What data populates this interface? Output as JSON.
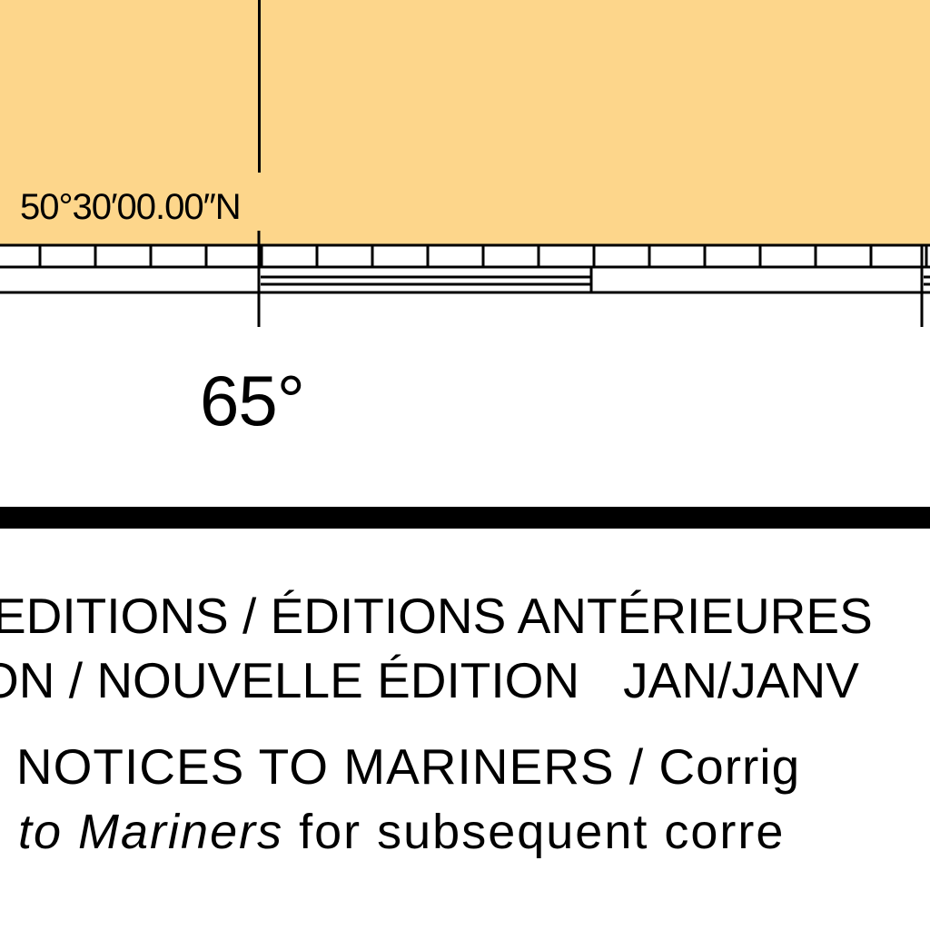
{
  "map": {
    "land_color": "#FDD68B",
    "latitude_label": "50°30′00.00″N",
    "longitude_label": "65°"
  },
  "notes": {
    "previous_editions": "EDITIONS / ÉDITIONS ANTÉRIEURES",
    "new_edition": "ON / NOUVELLE ÉDITION",
    "new_edition_date": "JAN/JANV",
    "notices_heading": "o NOTICES TO MARINERS / Corrig",
    "notices_italic": "to Mariners",
    "notices_rest": "for subsequent corre"
  }
}
